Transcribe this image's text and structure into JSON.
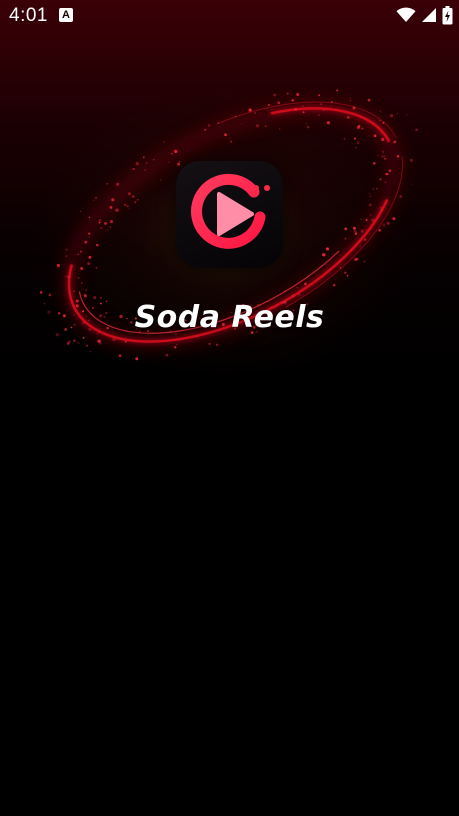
{
  "status_bar": {
    "time": "4:01",
    "notification_icon": "a-letter-icon",
    "notification_letter": "A",
    "icons": [
      "wifi-icon",
      "cell-signal-icon",
      "battery-charging-icon"
    ]
  },
  "splash": {
    "app_name": "Soda Reels",
    "logo_icon": "play-ring-logo-icon"
  },
  "colors": {
    "background_top": "#3a0006",
    "background": "#000000",
    "ring_red": "#e0101e",
    "logo_pink": "#ff4d7a",
    "logo_red": "#ff1f4a",
    "text": "#ffffff"
  }
}
